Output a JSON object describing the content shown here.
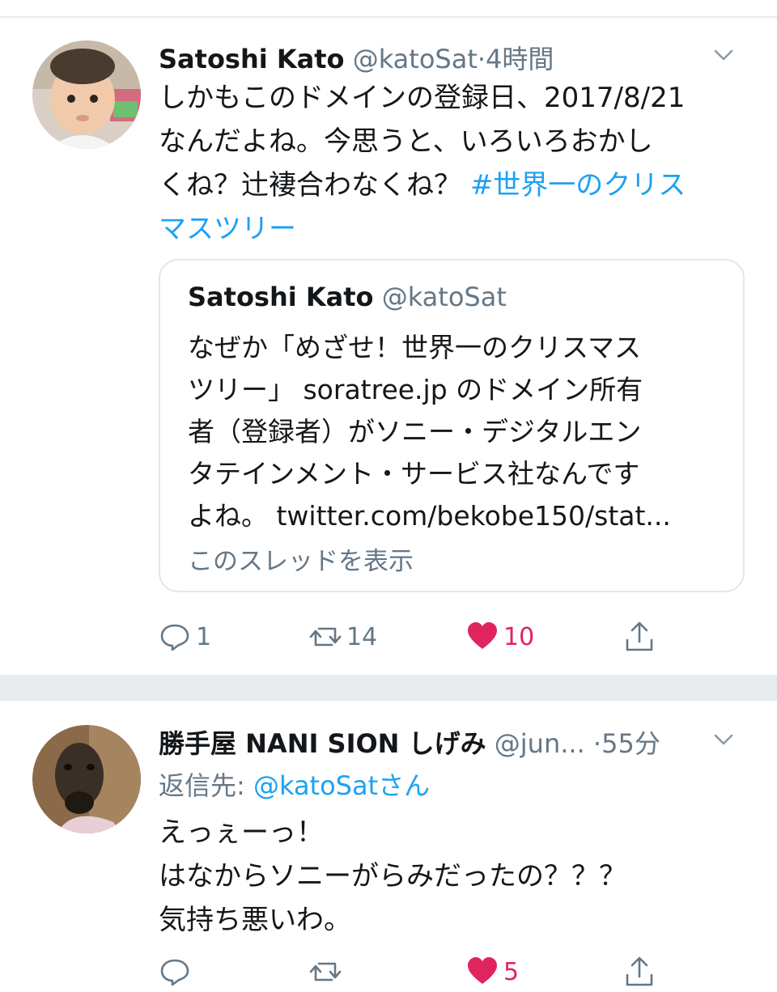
{
  "tweets": [
    {
      "author_name": "Satoshi Kato",
      "handle": "@katoSat",
      "separator": "·",
      "time": "4時間",
      "text_lines": [
        "しかもこのドメインの登録日、2017/8/21",
        "なんだよね。今思うと、いろいろおかし",
        "くね？辻褄合わなくね？ "
      ],
      "hashtag_part1": "#世界一のクリス",
      "hashtag_part2": "マスツリー",
      "quote": {
        "author_name": "Satoshi Kato",
        "handle": "@katoSat",
        "text_lines": [
          "なぜか「めざせ！世界一のクリスマス",
          "ツリー」 soratree.jp のドメイン所有",
          "者（登録者）がソニー・デジタルエン",
          "タテインメント・サービス社なんです",
          "よね。 twitter.com/bekobe150/stat..."
        ],
        "thread_link": "このスレッドを表示"
      },
      "actions": {
        "reply_count": "1",
        "retweet_count": "14",
        "like_count": "10",
        "liked": true
      }
    },
    {
      "author_name": "勝手屋 NANI SION しげみ",
      "handle": "@jun...",
      "separator": "·",
      "time": "55分",
      "reply_prefix": "返信先: ",
      "reply_mention": "@katoSatさん",
      "text_lines": [
        "えっぇーっ！",
        "はなからソニーがらみだったの？？？",
        "気持ち悪いわ。"
      ],
      "actions": {
        "reply_count": "",
        "retweet_count": "",
        "like_count": "5",
        "liked": true
      }
    }
  ],
  "icons": {
    "reply": "speech-bubble-icon",
    "retweet": "retweet-arrows-icon",
    "like": "heart-icon",
    "share": "share-upload-icon",
    "menu": "chevron-down-icon"
  },
  "colors": {
    "link_blue": "#1da1f2",
    "like_red": "#e0245e",
    "secondary_gray": "#657786",
    "separator": "#e6ecf0"
  }
}
